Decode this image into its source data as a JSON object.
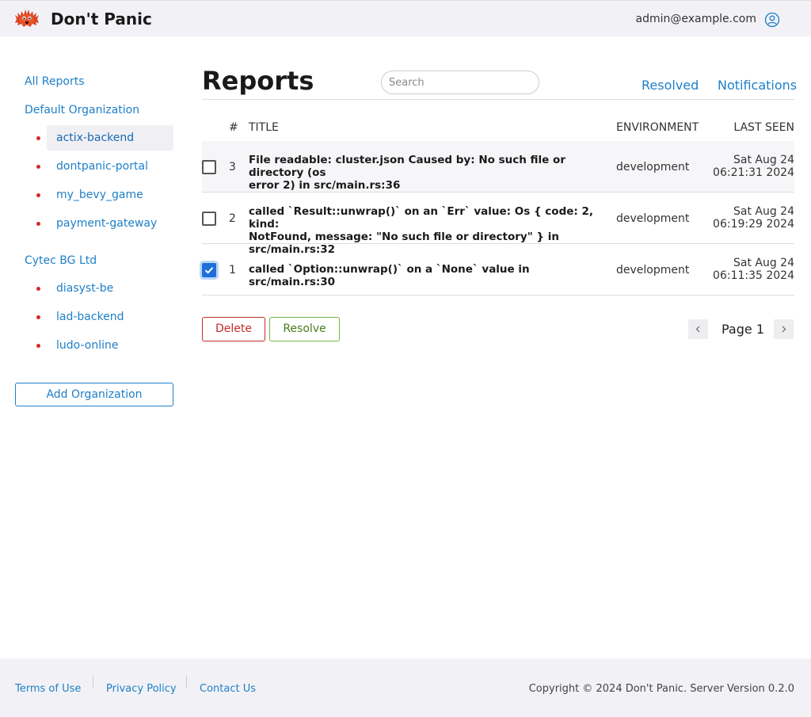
{
  "header": {
    "brand": "Don't Panic",
    "user_email": "admin@example.com"
  },
  "sidebar": {
    "all_reports": "All Reports",
    "organizations": [
      {
        "name": "Default Organization",
        "projects": [
          "actix-backend",
          "dontpanic-portal",
          "my_bevy_game",
          "payment-gateway"
        ]
      },
      {
        "name": "Cytec BG Ltd",
        "projects": [
          "diasyst-be",
          "lad-backend",
          "ludo-online"
        ]
      }
    ],
    "active_project": "actix-backend",
    "add_org_label": "Add Organization"
  },
  "main": {
    "title": "Reports",
    "search_placeholder": "Search",
    "resolved_link": "Resolved",
    "notifications_link": "Notifications",
    "columns": [
      "#",
      "TITLE",
      "ENVIRONMENT",
      "LAST SEEN"
    ],
    "rows": [
      {
        "num": "3",
        "title_line1": "File readable: cluster.json Caused by: No such file or directory (os",
        "title_line2": "error 2) in src/main.rs:36",
        "env": "development",
        "date": "Sat Aug 24",
        "time": "06:21:31 2024",
        "checked": false
      },
      {
        "num": "2",
        "title_line1": "called `Result::unwrap()` on an `Err` value: Os { code: 2, kind:",
        "title_line2": "NotFound, message: \"No such file or directory\" } in src/main.rs:32",
        "env": "development",
        "date": "Sat Aug 24",
        "time": "06:19:29 2024",
        "checked": false
      },
      {
        "num": "1",
        "title_line1": "called `Option::unwrap()` on a `None` value in src/main.rs:30",
        "title_line2": "",
        "env": "development",
        "date": "Sat Aug 24",
        "time": "06:11:35 2024",
        "checked": true
      }
    ],
    "delete_label": "Delete",
    "resolve_label": "Resolve",
    "page_label": "Page 1"
  },
  "footer": {
    "links": [
      "Terms of Use",
      "Privacy Policy",
      "Contact Us"
    ],
    "copyright": "Copyright © 2024 Don't Panic. Server Version 0.2.0"
  },
  "colors": {
    "accent": "#1e7fc8",
    "danger": "#c92a2a",
    "success": "#77b340",
    "checkbox": "#1e6fd9",
    "chrome_bg": "#f2f2f6"
  }
}
